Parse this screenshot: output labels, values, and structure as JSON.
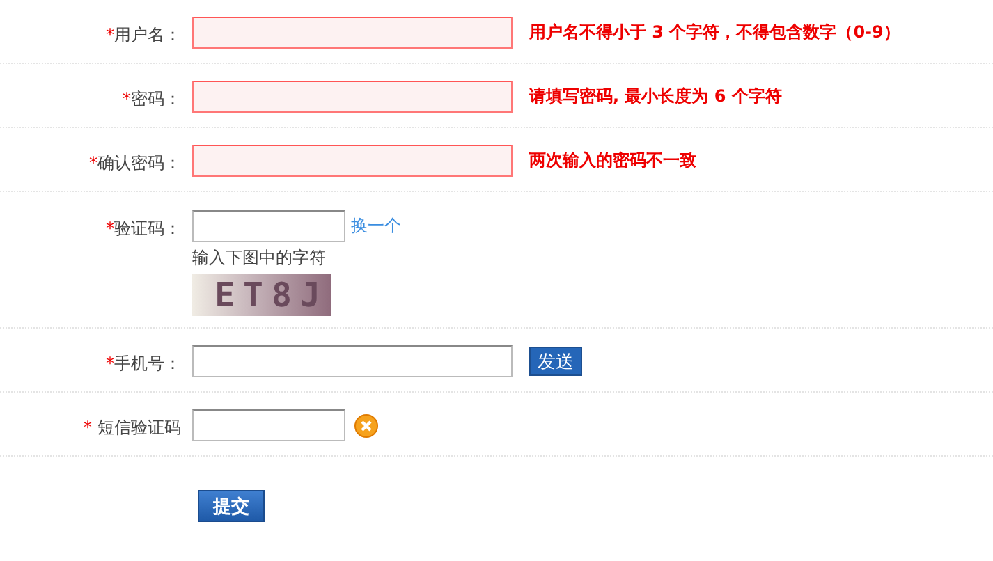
{
  "form": {
    "rows": [
      {
        "kind": "text",
        "mark": "*",
        "label": "用户名：",
        "wide": true,
        "error": true,
        "message": "用户名不得小于 3 个字符，不得包含数字（0-9）"
      },
      {
        "kind": "text",
        "mark": "*",
        "label": "密码：",
        "wide": true,
        "error": true,
        "message": "请填写密码, 最小长度为 6 个字符"
      },
      {
        "kind": "text",
        "mark": "*",
        "label": "确认密码：",
        "wide": true,
        "error": true,
        "message": "两次输入的密码不一致"
      },
      {
        "kind": "captcha",
        "mark": "*",
        "label": "验证码：",
        "wide": false,
        "error": false,
        "link": "换一个",
        "hint": "输入下图中的字符",
        "code": "ET8J"
      },
      {
        "kind": "send",
        "mark": "*",
        "label": "手机号：",
        "wide": true,
        "error": false,
        "button": "发送"
      },
      {
        "kind": "status",
        "mark": "*",
        "label": "短信验证码",
        "wide": false,
        "error": false,
        "invalid": true
      }
    ],
    "submit": "提交"
  }
}
